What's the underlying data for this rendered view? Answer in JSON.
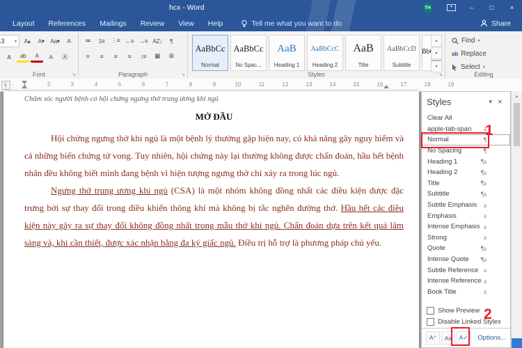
{
  "colors": {
    "titlebar_blue": "#2b579a",
    "annotation_red": "#ee1c25",
    "document_text_red": "#8a2a1e",
    "heading_blue": "#2e74b5",
    "avatar_teal": "#0f7c70"
  },
  "icons": {
    "minimize": "–",
    "maximize": "□",
    "close": "×",
    "caret_down": "▾",
    "gallery_up": "▴",
    "gallery_down": "▾",
    "gallery_more": "▾",
    "scroll_up": "▲",
    "launcher": "↘",
    "ruler_tab": "L",
    "replace_ab": "ab",
    "pilcrow": "¶"
  },
  "titlebar": {
    "title": "hcx - Word",
    "avatar_initials": "TH"
  },
  "ribbon": {
    "tabs": [
      "Layout",
      "References",
      "Mailings",
      "Review",
      "View",
      "Help"
    ],
    "tell_me": "Tell me what you want to do",
    "share_label": "Share",
    "font_group": {
      "label": "Font",
      "font_size_value": "13",
      "row1": [
        {
          "name": "grow-font-button",
          "glyph": "A▴"
        },
        {
          "name": "shrink-font-button",
          "glyph": "A▾"
        },
        {
          "name": "change-case-button",
          "glyph": "Aa▾"
        },
        {
          "name": "clear-formatting-button",
          "glyph": "A"
        }
      ],
      "row2": [
        {
          "name": "text-effects-button",
          "glyph": "A"
        },
        {
          "name": "highlight-color-button",
          "glyph": "ab"
        },
        {
          "name": "font-color-button",
          "glyph": "A"
        },
        {
          "name": "character-shading-button",
          "glyph": "A"
        },
        {
          "name": "enclose-characters-button",
          "glyph": "Ⓐ"
        }
      ]
    },
    "paragraph_group": {
      "label": "Paragraph",
      "row1": [
        {
          "name": "bullets-button",
          "glyph": "≔"
        },
        {
          "name": "numbering-button",
          "glyph": "1≡"
        },
        {
          "name": "multilevel-list-button",
          "glyph": "⋮≡"
        },
        {
          "name": "decrease-indent-button",
          "glyph": "←≡"
        },
        {
          "name": "increase-indent-button",
          "glyph": "→≡"
        },
        {
          "name": "sort-button",
          "glyph": "AZ↓"
        },
        {
          "name": "show-marks-button",
          "glyph": "¶"
        }
      ],
      "row2": [
        {
          "name": "align-left-button",
          "glyph": "≡"
        },
        {
          "name": "align-center-button",
          "glyph": "≡"
        },
        {
          "name": "align-right-button",
          "glyph": "≡"
        },
        {
          "name": "justify-button",
          "glyph": "≡"
        },
        {
          "name": "line-spacing-button",
          "glyph": "↕≡"
        },
        {
          "name": "shading-button",
          "glyph": "▦"
        },
        {
          "name": "borders-button",
          "glyph": "⊞"
        }
      ]
    },
    "styles_group": {
      "label": "Styles",
      "gallery": [
        {
          "kind": "normal",
          "preview": "AaBbCc",
          "label": "Normal"
        },
        {
          "kind": "no-spacing",
          "preview": "AaBbCc",
          "label": "No Spac..."
        },
        {
          "kind": "heading-1",
          "preview": "AaB",
          "label": "Heading 1"
        },
        {
          "kind": "heading-2",
          "preview": "AaBbCcC",
          "label": "Heading 2"
        },
        {
          "kind": "title",
          "preview": "AaB",
          "label": "Title"
        },
        {
          "kind": "subtitle",
          "preview": "AaBbCcD",
          "label": "Subtitle"
        },
        {
          "kind": "partial",
          "preview": "AaBbCcD",
          "label": ""
        }
      ]
    },
    "editing_group": {
      "label": "Editing",
      "items": [
        {
          "name": "find",
          "label": "Find"
        },
        {
          "name": "replace",
          "label": "Replace"
        },
        {
          "name": "select",
          "label": "Select"
        }
      ]
    }
  },
  "ruler": {
    "numbers": [
      "1",
      "2",
      "3",
      "4",
      "5",
      "6",
      "7",
      "8",
      "9",
      "10",
      "11",
      "12",
      "13",
      "14",
      "15",
      "16",
      "17",
      "18",
      "19"
    ]
  },
  "document": {
    "header_text": "Chăm sóc người bệnh có hội chứng ngưng thở trung ương khi ngủ",
    "section_title": "MỞ ĐẦU",
    "paragraph_1": "Hội chứng ngưng thở khi ngủ là một bệnh lý thường gặp hiện nay, có khả năng gây nguy hiểm và cả những biến chứng tử vong. Tuy nhiên, hội chứng này lại thường không được chẩn đoán, hầu hết bệnh nhân đều không biết mình đang bệnh vì hiện tượng ngưng thở chỉ xảy ra trong lúc ngủ.",
    "paragraph_2_segments": [
      {
        "text": "Ngưng thở trung ương khi ngủ",
        "underline": true
      },
      {
        "text": " (CSA) là một nhóm không đồng nhất các điều kiện được đặc trưng bởi sự thay đổi trong điều khiển thông khí mà không bị tắc nghẽn đường thở. ",
        "underline": false
      },
      {
        "text": "Hầu hết các điều kiện này gây ra sự thay đổi không đồng nhất trong mẫu thở khi ngủ. Chẩn đoán dựa trên kết quả lâm sàng và, khi cần thiết, được xác nhận bằng đa ký giấc ngủ.",
        "underline": true
      },
      {
        "text": " Điều trị hỗ trợ là phương pháp chủ yếu.",
        "underline": false
      }
    ]
  },
  "styles_pane": {
    "title": "Styles",
    "items": [
      {
        "label": "Clear All",
        "marker": ""
      },
      {
        "label": "apple-tab-span",
        "marker": "a"
      },
      {
        "label": "Normal",
        "marker": "¶",
        "highlighted": true
      },
      {
        "label": "No Spacing",
        "marker": "¶"
      },
      {
        "label": "Heading 1",
        "marker": "¶a"
      },
      {
        "label": "Heading 2",
        "marker": "¶a"
      },
      {
        "label": "Title",
        "marker": "¶a"
      },
      {
        "label": "Subtitle",
        "marker": "¶a"
      },
      {
        "label": "Subtle Emphasis",
        "marker": "a"
      },
      {
        "label": "Emphasis",
        "marker": "a"
      },
      {
        "label": "Intense Emphasis",
        "marker": "a"
      },
      {
        "label": "Strong",
        "marker": "a"
      },
      {
        "label": "Quote",
        "marker": "¶a"
      },
      {
        "label": "Intense Quote",
        "marker": "¶a"
      },
      {
        "label": "Subtle Reference",
        "marker": "a"
      },
      {
        "label": "Intense Reference",
        "marker": "a"
      },
      {
        "label": "Book Title",
        "marker": "a"
      }
    ],
    "show_preview_label": "Show Preview",
    "disable_linked_label": "Disable Linked Styles",
    "options_label": "Options...",
    "footer_buttons": [
      {
        "name": "new-style-button",
        "glyph": "A⁺"
      },
      {
        "name": "style-inspector-button",
        "glyph": "Aa"
      },
      {
        "name": "manage-styles-button",
        "glyph": "A✓"
      }
    ]
  },
  "annotations": {
    "step_1": "1",
    "step_2": "2"
  }
}
